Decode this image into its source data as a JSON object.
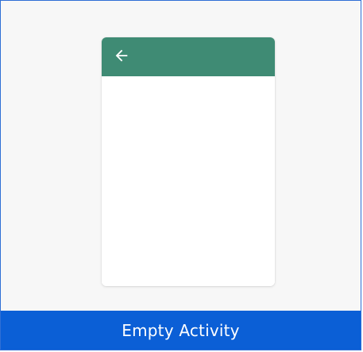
{
  "template": {
    "name": "Empty Activity",
    "preview": {
      "app_bar_icon": "arrow-back-icon"
    }
  },
  "colors": {
    "border": "#2f6fd6",
    "card_background": "#f7f7f7",
    "app_bar": "#3f8b74",
    "footer": "#0b5fd6",
    "footer_text": "#ffffff"
  }
}
